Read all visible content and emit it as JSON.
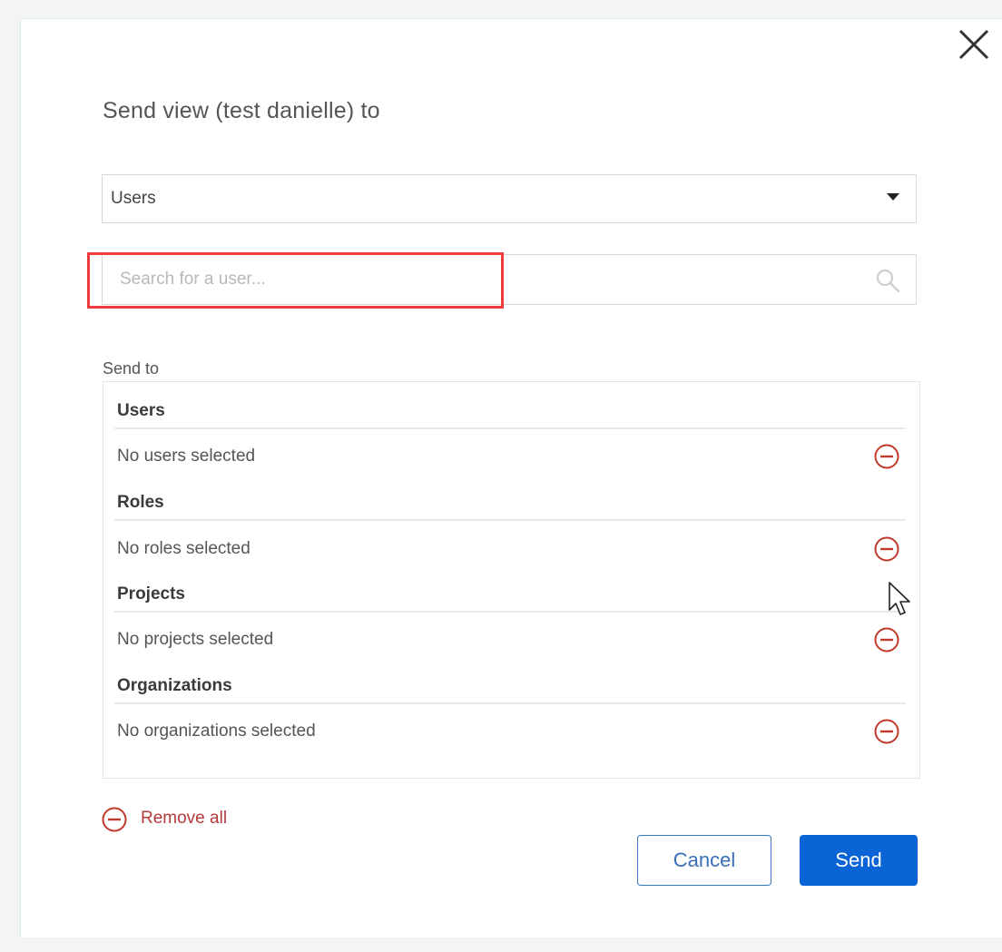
{
  "dialog": {
    "title": "Send view (test danielle) to",
    "close_icon": "close-icon"
  },
  "recipient_type_select": {
    "selected": "Users",
    "icon": "caret-down-icon"
  },
  "search": {
    "placeholder": "Search for a user...",
    "value": "",
    "icon": "search-icon",
    "highlight_color": "#ef3b3b"
  },
  "send_to": {
    "label": "Send to",
    "sections": [
      {
        "title": "Users",
        "empty_text": "No users selected"
      },
      {
        "title": "Roles",
        "empty_text": "No roles selected"
      },
      {
        "title": "Projects",
        "empty_text": "No projects selected"
      },
      {
        "title": "Organizations",
        "empty_text": "No organizations selected"
      }
    ],
    "remove_icon": "minus-circle-icon",
    "remove_color": "#c0392b"
  },
  "footer": {
    "remove_all_label": "Remove all",
    "cancel_label": "Cancel",
    "send_label": "Send",
    "primary_color": "#0b64d6"
  },
  "pointer": "mouse-cursor-icon"
}
